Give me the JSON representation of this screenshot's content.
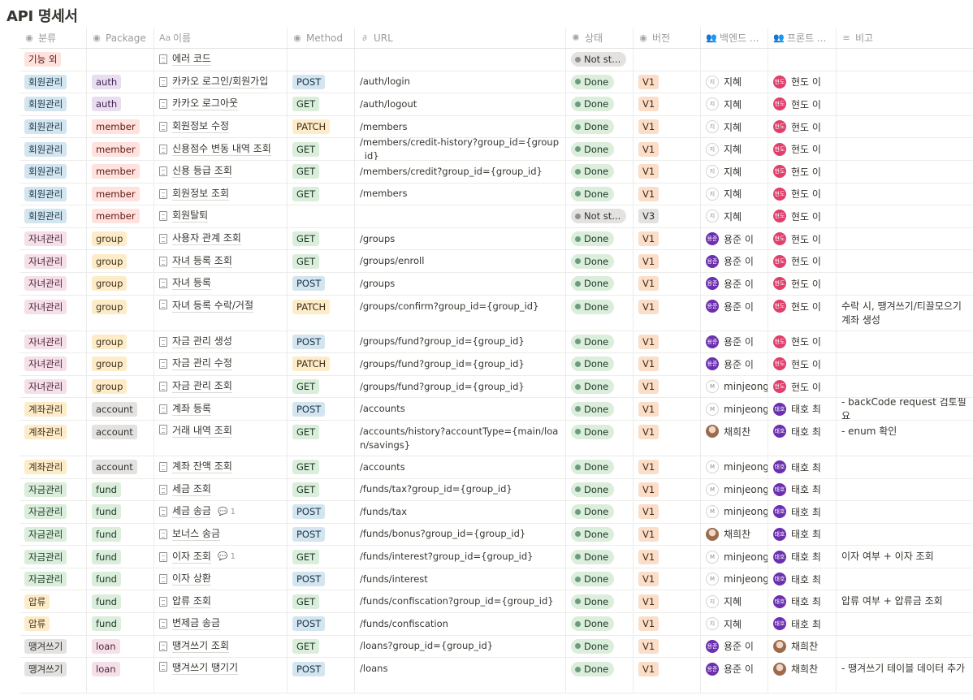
{
  "page_title": "API 명세서",
  "columns": [
    "분류",
    "Package",
    "이름",
    "Method",
    "URL",
    "상태",
    "버전",
    "백엔드 ...",
    "프론트 ...",
    "비고"
  ],
  "column_icons": [
    "dropdown-icon",
    "dropdown-icon",
    "text-icon",
    "dropdown-icon",
    "link-icon",
    "status-icon",
    "dropdown-icon",
    "people-icon",
    "people-icon",
    "lines-icon"
  ],
  "column_icon_glyphs": [
    "◉",
    "◉",
    "Aa",
    "◉",
    "∂",
    "✺",
    "◉",
    "👥",
    "👥",
    "≡"
  ],
  "category_colors": {
    "기능 외": {
      "bg": "#ffe2dd",
      "fg": "#5d1715"
    },
    "회원관리": {
      "bg": "#d3e5ef",
      "fg": "#183347"
    },
    "자녀관리": {
      "bg": "#f5e0e9",
      "fg": "#4c2337"
    },
    "계좌관리": {
      "bg": "#fdecc8",
      "fg": "#402c1b"
    },
    "자금관리": {
      "bg": "#dbeddb",
      "fg": "#1c3829"
    },
    "압류": {
      "bg": "#fdecc8",
      "fg": "#402c1b"
    },
    "땡겨쓰기": {
      "bg": "#e3e2e0",
      "fg": "#32302c"
    }
  },
  "package_colors": {
    "auth": {
      "bg": "#e8deee",
      "fg": "#412454"
    },
    "member": {
      "bg": "#ffe2dd",
      "fg": "#5d1715"
    },
    "group": {
      "bg": "#fdecc8",
      "fg": "#402c1b"
    },
    "account": {
      "bg": "#e3e2e0",
      "fg": "#32302c"
    },
    "fund": {
      "bg": "#dbeddb",
      "fg": "#1c3829"
    },
    "loan": {
      "bg": "#f5e0e9",
      "fg": "#4c2337"
    }
  },
  "method_colors": {
    "POST": {
      "bg": "#d3e5ef",
      "fg": "#183347"
    },
    "GET": {
      "bg": "#dbeddb",
      "fg": "#1c3829"
    },
    "PATCH": {
      "bg": "#fdecc8",
      "fg": "#402c1b"
    }
  },
  "version_color": {
    "bg": "#fadec9",
    "fg": "#49290e"
  },
  "version_v3_color": {
    "bg": "#e3e2e0",
    "fg": "#32302c"
  },
  "rows": [
    {
      "category": "기능 외",
      "package": "",
      "name": "에러 코드",
      "comments": "",
      "method": "",
      "url": "",
      "status": "Not st...",
      "version": "",
      "backend": "",
      "backend_avatar": "",
      "backend_avatar_text": "",
      "frontend": "",
      "frontend_avatar": "",
      "frontend_avatar_text": "",
      "note": ""
    },
    {
      "category": "회원관리",
      "package": "auth",
      "name": "카카오 로그인/회원가입",
      "comments": "",
      "method": "POST",
      "url": "/auth/login",
      "status": "Done",
      "version": "V1",
      "backend": "지혜",
      "backend_avatar": "light",
      "backend_avatar_text": "지",
      "frontend": "현도 이",
      "frontend_avatar": "pink",
      "frontend_avatar_text": "현도",
      "note": ""
    },
    {
      "category": "회원관리",
      "package": "auth",
      "name": "카카오 로그아웃",
      "comments": "",
      "method": "GET",
      "url": "/auth/logout",
      "status": "Done",
      "version": "V1",
      "backend": "지혜",
      "backend_avatar": "light",
      "backend_avatar_text": "지",
      "frontend": "현도 이",
      "frontend_avatar": "pink",
      "frontend_avatar_text": "현도",
      "note": ""
    },
    {
      "category": "회원관리",
      "package": "member",
      "name": "회원정보 수정",
      "comments": "",
      "method": "PATCH",
      "url": "/members",
      "status": "Done",
      "version": "V1",
      "backend": "지혜",
      "backend_avatar": "light",
      "backend_avatar_text": "지",
      "frontend": "현도 이",
      "frontend_avatar": "pink",
      "frontend_avatar_text": "현도",
      "note": ""
    },
    {
      "category": "회원관리",
      "package": "member",
      "name": "신용점수 변동 내역 조회",
      "comments": "",
      "method": "GET",
      "url": "/members/credit-history?group_id={group_id}",
      "status": "Done",
      "version": "V1",
      "backend": "지혜",
      "backend_avatar": "light",
      "backend_avatar_text": "지",
      "frontend": "현도 이",
      "frontend_avatar": "pink",
      "frontend_avatar_text": "현도",
      "note": ""
    },
    {
      "category": "회원관리",
      "package": "member",
      "name": "신용 등급 조회",
      "comments": "",
      "method": "GET",
      "url": "/members/credit?group_id={group_id}",
      "status": "Done",
      "version": "V1",
      "backend": "지혜",
      "backend_avatar": "light",
      "backend_avatar_text": "지",
      "frontend": "현도 이",
      "frontend_avatar": "pink",
      "frontend_avatar_text": "현도",
      "note": ""
    },
    {
      "category": "회원관리",
      "package": "member",
      "name": "회원정보 조회",
      "comments": "",
      "method": "GET",
      "url": "/members",
      "status": "Done",
      "version": "V1",
      "backend": "지혜",
      "backend_avatar": "light",
      "backend_avatar_text": "지",
      "frontend": "현도 이",
      "frontend_avatar": "pink",
      "frontend_avatar_text": "현도",
      "note": ""
    },
    {
      "category": "회원관리",
      "package": "member",
      "name": "회원탈퇴",
      "comments": "",
      "method": "",
      "url": "",
      "status": "Not st...",
      "version": "V3",
      "backend": "지혜",
      "backend_avatar": "light",
      "backend_avatar_text": "지",
      "frontend": "현도 이",
      "frontend_avatar": "pink",
      "frontend_avatar_text": "현도",
      "note": ""
    },
    {
      "category": "자녀관리",
      "package": "group",
      "name": "사용자 관계 조회",
      "comments": "",
      "method": "GET",
      "url": "/groups",
      "status": "Done",
      "version": "V1",
      "backend": "용준 이",
      "backend_avatar": "purple",
      "backend_avatar_text": "용준",
      "frontend": "현도 이",
      "frontend_avatar": "pink",
      "frontend_avatar_text": "현도",
      "note": ""
    },
    {
      "category": "자녀관리",
      "package": "group",
      "name": "자녀 등록 조회",
      "comments": "",
      "method": "GET",
      "url": "/groups/enroll",
      "status": "Done",
      "version": "V1",
      "backend": "용준 이",
      "backend_avatar": "purple",
      "backend_avatar_text": "용준",
      "frontend": "현도 이",
      "frontend_avatar": "pink",
      "frontend_avatar_text": "현도",
      "note": ""
    },
    {
      "category": "자녀관리",
      "package": "group",
      "name": "자녀 등록",
      "comments": "",
      "method": "POST",
      "url": "/groups",
      "status": "Done",
      "version": "V1",
      "backend": "용준 이",
      "backend_avatar": "purple",
      "backend_avatar_text": "용준",
      "frontend": "현도 이",
      "frontend_avatar": "pink",
      "frontend_avatar_text": "현도",
      "note": ""
    },
    {
      "category": "자녀관리",
      "package": "group",
      "name": "자녀 등록 수락/거절",
      "comments": "",
      "method": "PATCH",
      "url": "/groups/confirm?group_id={group_id}",
      "status": "Done",
      "version": "V1",
      "backend": "용준 이",
      "backend_avatar": "purple",
      "backend_avatar_text": "용준",
      "frontend": "현도 이",
      "frontend_avatar": "pink",
      "frontend_avatar_text": "현도",
      "note": "수락 시, 땡겨쓰기/티끌모으기 계좌 생성"
    },
    {
      "category": "자녀관리",
      "package": "group",
      "name": "자금 관리 생성",
      "comments": "",
      "method": "POST",
      "url": "/groups/fund?group_id={group_id}",
      "status": "Done",
      "version": "V1",
      "backend": "용준 이",
      "backend_avatar": "purple",
      "backend_avatar_text": "용준",
      "frontend": "현도 이",
      "frontend_avatar": "pink",
      "frontend_avatar_text": "현도",
      "note": ""
    },
    {
      "category": "자녀관리",
      "package": "group",
      "name": "자금 관리 수정",
      "comments": "",
      "method": "PATCH",
      "url": "/groups/fund?group_id={group_id}",
      "status": "Done",
      "version": "V1",
      "backend": "용준 이",
      "backend_avatar": "purple",
      "backend_avatar_text": "용준",
      "frontend": "현도 이",
      "frontend_avatar": "pink",
      "frontend_avatar_text": "현도",
      "note": ""
    },
    {
      "category": "자녀관리",
      "package": "group",
      "name": "자금 관리 조회",
      "comments": "",
      "method": "GET",
      "url": "/groups/fund?group_id={group_id}",
      "status": "Done",
      "version": "V1",
      "backend": "minjeong l",
      "backend_avatar": "light",
      "backend_avatar_text": "M",
      "frontend": "현도 이",
      "frontend_avatar": "pink",
      "frontend_avatar_text": "현도",
      "note": ""
    },
    {
      "category": "계좌관리",
      "package": "account",
      "name": "계좌 등록",
      "comments": "",
      "method": "POST",
      "url": "/accounts",
      "status": "Done",
      "version": "V1",
      "backend": "minjeong l",
      "backend_avatar": "light",
      "backend_avatar_text": "M",
      "frontend": "태호 최",
      "frontend_avatar": "purple",
      "frontend_avatar_text": "태호",
      "note": "- backCode request 검토필요"
    },
    {
      "category": "계좌관리",
      "package": "account",
      "name": "거래 내역 조회",
      "comments": "",
      "method": "GET",
      "url": "/accounts/history?accountType={main/loan/savings}",
      "status": "Done",
      "version": "V1",
      "backend": "채희찬",
      "backend_avatar": "photo",
      "backend_avatar_text": "",
      "frontend": "태호 최",
      "frontend_avatar": "purple",
      "frontend_avatar_text": "태호",
      "note": "- enum 확인"
    },
    {
      "category": "계좌관리",
      "package": "account",
      "name": "계좌 잔액 조회",
      "comments": "",
      "method": "GET",
      "url": "/accounts",
      "status": "Done",
      "version": "V1",
      "backend": "minjeong l",
      "backend_avatar": "light",
      "backend_avatar_text": "M",
      "frontend": "태호 최",
      "frontend_avatar": "purple",
      "frontend_avatar_text": "태호",
      "note": ""
    },
    {
      "category": "자금관리",
      "package": "fund",
      "name": "세금 조회",
      "comments": "",
      "method": "GET",
      "url": "/funds/tax?group_id={group_id}",
      "status": "Done",
      "version": "V1",
      "backend": "minjeong l",
      "backend_avatar": "light",
      "backend_avatar_text": "M",
      "frontend": "태호 최",
      "frontend_avatar": "purple",
      "frontend_avatar_text": "태호",
      "note": ""
    },
    {
      "category": "자금관리",
      "package": "fund",
      "name": "세금 송금",
      "comments": "1",
      "method": "POST",
      "url": "/funds/tax",
      "status": "Done",
      "version": "V1",
      "backend": "minjeong l",
      "backend_avatar": "light",
      "backend_avatar_text": "M",
      "frontend": "태호 최",
      "frontend_avatar": "purple",
      "frontend_avatar_text": "태호",
      "note": ""
    },
    {
      "category": "자금관리",
      "package": "fund",
      "name": "보너스 송금",
      "comments": "",
      "method": "POST",
      "url": "/funds/bonus?group_id={group_id}",
      "status": "Done",
      "version": "V1",
      "backend": "채희찬",
      "backend_avatar": "photo",
      "backend_avatar_text": "",
      "frontend": "태호 최",
      "frontend_avatar": "purple",
      "frontend_avatar_text": "태호",
      "note": ""
    },
    {
      "category": "자금관리",
      "package": "fund",
      "name": "이자 조회",
      "comments": "1",
      "method": "GET",
      "url": "/funds/interest?group_id={group_id}",
      "status": "Done",
      "version": "V1",
      "backend": "minjeong l",
      "backend_avatar": "light",
      "backend_avatar_text": "M",
      "frontend": "태호 최",
      "frontend_avatar": "purple",
      "frontend_avatar_text": "태호",
      "note": "이자 여부 + 이자 조회"
    },
    {
      "category": "자금관리",
      "package": "fund",
      "name": "이자 상환",
      "comments": "",
      "method": "POST",
      "url": "/funds/interest",
      "status": "Done",
      "version": "V1",
      "backend": "minjeong l",
      "backend_avatar": "light",
      "backend_avatar_text": "M",
      "frontend": "태호 최",
      "frontend_avatar": "purple",
      "frontend_avatar_text": "태호",
      "note": ""
    },
    {
      "category": "압류",
      "package": "fund",
      "name": "압류 조회",
      "comments": "",
      "method": "GET",
      "url": "/funds/confiscation?group_id={group_id}",
      "status": "Done",
      "version": "V1",
      "backend": "지혜",
      "backend_avatar": "light",
      "backend_avatar_text": "지",
      "frontend": "태호 최",
      "frontend_avatar": "purple",
      "frontend_avatar_text": "태호",
      "note": "압류 여부 + 압류금 조회"
    },
    {
      "category": "압류",
      "package": "fund",
      "name": "변제금 송금",
      "comments": "",
      "method": "POST",
      "url": "/funds/confiscation",
      "status": "Done",
      "version": "V1",
      "backend": "지혜",
      "backend_avatar": "light",
      "backend_avatar_text": "지",
      "frontend": "태호 최",
      "frontend_avatar": "purple",
      "frontend_avatar_text": "태호",
      "note": ""
    },
    {
      "category": "땡겨쓰기",
      "package": "loan",
      "name": "땡겨쓰기 조회",
      "comments": "",
      "method": "GET",
      "url": "/loans?group_id={group_id}",
      "status": "Done",
      "version": "V1",
      "backend": "용준 이",
      "backend_avatar": "purple",
      "backend_avatar_text": "용준",
      "frontend": "채희찬",
      "frontend_avatar": "photo",
      "frontend_avatar_text": "",
      "note": ""
    },
    {
      "category": "땡겨쓰기",
      "package": "loan",
      "name": "땡겨쓰기 땡기기",
      "comments": "",
      "method": "POST",
      "url": "/loans",
      "status": "Done",
      "version": "V1",
      "backend": "용준 이",
      "backend_avatar": "purple",
      "backend_avatar_text": "용준",
      "frontend": "채희찬",
      "frontend_avatar": "photo",
      "frontend_avatar_text": "",
      "note": "- 땡겨쓰기 테이블 데이터 추가"
    }
  ]
}
